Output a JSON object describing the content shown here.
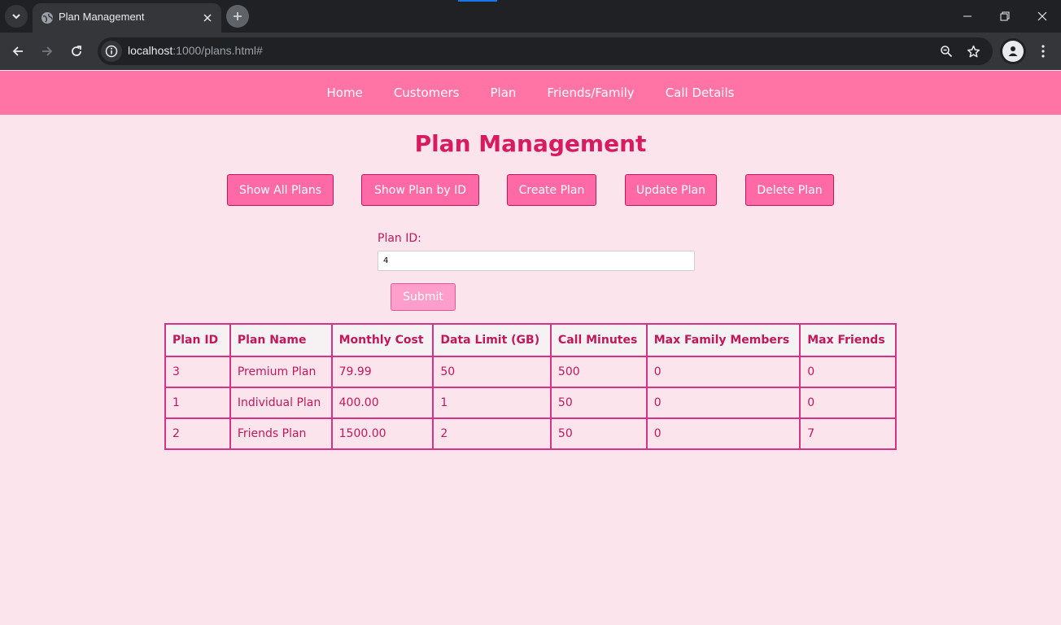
{
  "browser": {
    "tab_title": "Plan Management",
    "url_host": "localhost",
    "url_rest": ":1000/plans.html#"
  },
  "nav": {
    "items": [
      {
        "label": "Home"
      },
      {
        "label": "Customers"
      },
      {
        "label": "Plan"
      },
      {
        "label": "Friends/Family"
      },
      {
        "label": "Call Details"
      }
    ]
  },
  "page": {
    "title": "Plan Management"
  },
  "actions": {
    "show_all": "Show All Plans",
    "show_by_id": "Show Plan by ID",
    "create": "Create Plan",
    "update": "Update Plan",
    "delete": "Delete Plan"
  },
  "form": {
    "label": "Plan ID:",
    "value": "4",
    "submit": "Submit"
  },
  "table": {
    "headers": [
      "Plan ID",
      "Plan Name",
      "Monthly Cost",
      "Data Limit (GB)",
      "Call Minutes",
      "Max Family Members",
      "Max Friends"
    ],
    "rows": [
      [
        "3",
        "Premium Plan",
        "79.99",
        "50",
        "500",
        "0",
        "0"
      ],
      [
        "1",
        "Individual Plan",
        "400.00",
        "1",
        "50",
        "0",
        "0"
      ],
      [
        "2",
        "Friends Plan",
        "1500.00",
        "2",
        "50",
        "0",
        "7"
      ]
    ]
  },
  "colors": {
    "nav_bg": "#ff74a4",
    "page_bg": "#fce4ec",
    "title": "#d81b60",
    "button": "#ff69a6",
    "table_border": "#d63384"
  }
}
